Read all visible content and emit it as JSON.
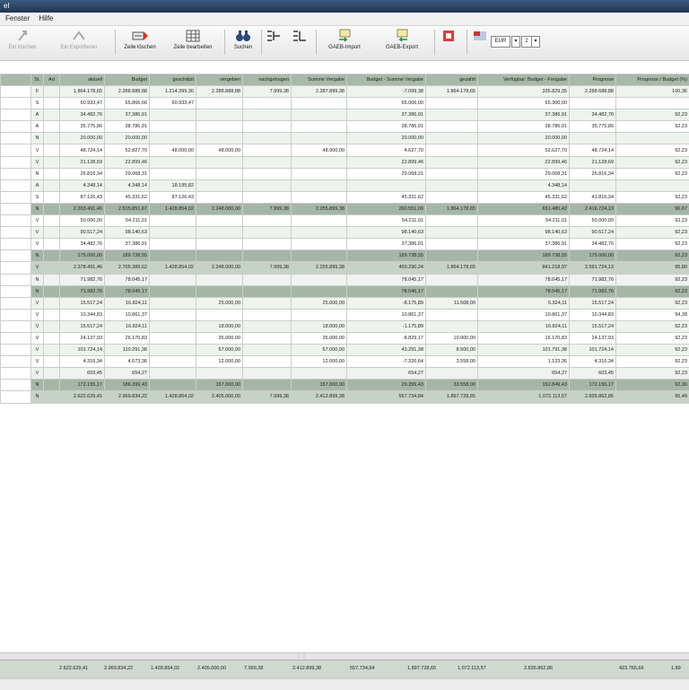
{
  "window": {
    "title": "el"
  },
  "menu": {
    "items": [
      "Fenster",
      "Hilfe"
    ]
  },
  "toolbar": {
    "buttons": [
      {
        "label": "Ein löschen",
        "icon": "disabled-arrow-icon"
      },
      {
        "label": "Ein Exportieren",
        "icon": "disabled-export-icon"
      },
      {
        "label": "Zeile löschen",
        "icon": "delete-row-icon"
      },
      {
        "label": "Zeile bearbeiten",
        "icon": "edit-row-icon"
      },
      {
        "label": "Suchen",
        "icon": "binoculars-icon"
      },
      {
        "label": "GAEB-Import",
        "icon": "gaeb-import-icon"
      },
      {
        "label": "GAEB-Export",
        "icon": "gaeb-export-icon"
      }
    ],
    "currency": "EUR",
    "decimals": "2"
  },
  "table": {
    "headers": [
      "",
      "St.",
      "Art",
      "aktuell",
      "Budget",
      "geschätzt",
      "vergeben",
      "nachgetragen",
      "Summe Vergabe",
      "Budget - Summe Vergabe",
      "gezahlt",
      "Verfügbar: Budget - Freigabe",
      "Prognose",
      "Prognose / Budget (%)"
    ],
    "rows": [
      {
        "type": "row",
        "c": [
          "",
          "F",
          "",
          "1.864.178,65",
          "2.288.888,88",
          "1.214.399,30",
          "2.288.888,88",
          "7.999,38",
          "2.287.899,38",
          "-7.099,38",
          "1.864.178,65",
          "335.829,35",
          "2.288.688,88",
          "100,36"
        ]
      },
      {
        "type": "row",
        "c": [
          "",
          "S",
          "",
          "60.933,47",
          "65.866,66",
          "60.933,47",
          "",
          "",
          "",
          "65.006,00",
          "",
          "65.300,00",
          "",
          ""
        ]
      },
      {
        "type": "row",
        "c": [
          "",
          "A",
          "",
          "34.482,76",
          "37.386,91",
          "",
          "",
          "",
          "",
          "37.386,91",
          "",
          "37.386,91",
          "34.482,76",
          "92,23"
        ]
      },
      {
        "type": "row",
        "c": [
          "",
          "A",
          "",
          "35.775,86",
          "38.786,91",
          "",
          "",
          "",
          "",
          "38.786,91",
          "",
          "38.786,91",
          "35.775,86",
          "92,23"
        ]
      },
      {
        "type": "row",
        "c": [
          "",
          "N",
          "",
          "20.000,00",
          "20.000,00",
          "",
          "",
          "",
          "",
          "20.000,00",
          "",
          "20.000,00",
          "",
          ""
        ]
      },
      {
        "type": "row",
        "c": [
          "",
          "V",
          "",
          "48.724,14",
          "52.827,70",
          "48.000,00",
          "48.000,00",
          "",
          "48.900,00",
          "4.627,70",
          "",
          "52.627,70",
          "48.724,14",
          "92,23"
        ]
      },
      {
        "type": "row",
        "c": [
          "",
          "V",
          "",
          "21.128,69",
          "22.899,46",
          "",
          "",
          "",
          "",
          "22.899,46",
          "",
          "22.899,46",
          "21.128,69",
          "92,23"
        ]
      },
      {
        "type": "row",
        "c": [
          "",
          "N",
          "",
          "26.816,34",
          "29.068,31",
          "",
          "",
          "",
          "",
          "29.068,31",
          "",
          "29.068,31",
          "26.816,34",
          "92,23"
        ]
      },
      {
        "type": "row",
        "c": [
          "",
          "A",
          "",
          "4.348,14",
          "4.348,14",
          "18.195,82",
          "",
          "",
          "",
          "",
          "",
          "4.348,14",
          "",
          ""
        ]
      },
      {
        "type": "row",
        "c": [
          "",
          "S",
          "",
          "87.126,43",
          "45.331,62",
          "87.126,43",
          "",
          "",
          "",
          "45.331,62",
          "",
          "45.331,62",
          "41.816,34",
          "92,23"
        ]
      },
      {
        "type": "sum",
        "c": [
          "",
          "N",
          "",
          "2.203.491,46",
          "2.515.851,67",
          "1.428.854,02",
          "2.248.000,00",
          "7.999,38",
          "2.255.899,38",
          "260.551,69",
          "1.864.178,65",
          "651.480,42",
          "2.416.724,13",
          "96,67"
        ]
      },
      {
        "type": "row",
        "c": [
          "",
          "V",
          "",
          "50.000,00",
          "54.211,01",
          "",
          "",
          "",
          "",
          "54.211,01",
          "",
          "54.211,01",
          "50.000,00",
          "92,23"
        ]
      },
      {
        "type": "row",
        "c": [
          "",
          "V",
          "",
          "90.517,24",
          "98.140,63",
          "",
          "",
          "",
          "",
          "98.140,63",
          "",
          "98.140,63",
          "90.517,24",
          "92,23"
        ]
      },
      {
        "type": "row",
        "c": [
          "",
          "V",
          "",
          "34.482,76",
          "37.386,91",
          "",
          "",
          "",
          "",
          "37.386,91",
          "",
          "37.386,91",
          "34.482,76",
          "92,23"
        ]
      },
      {
        "type": "sum",
        "c": [
          "",
          "N",
          "",
          "175.000,00",
          "189.738,55",
          "",
          "",
          "",
          "",
          "189.738,55",
          "",
          "189.738,55",
          "175.000,00",
          "92,23"
        ]
      },
      {
        "type": "sum2",
        "c": [
          "",
          "V",
          "",
          "2.378.491,46",
          "2.705.389,62",
          "1.428.854,02",
          "2.248.000,00",
          "7.999,38",
          "2.255.899,38",
          "450.290,24",
          "1.864.178,65",
          "841.218,97",
          "2.591.724,13",
          "95,80"
        ]
      },
      {
        "type": "row",
        "c": [
          "",
          "N",
          "",
          "71.982,76",
          "78.045,17",
          "",
          "",
          "",
          "",
          "78.045,17",
          "",
          "78.045,17",
          "71.982,76",
          "92,23"
        ]
      },
      {
        "type": "sum",
        "c": [
          "",
          "N",
          "",
          "71.982,76",
          "78.045,17",
          "",
          "",
          "",
          "",
          "78.045,17",
          "",
          "78.045,17",
          "71.982,76",
          "92,23"
        ]
      },
      {
        "type": "row",
        "c": [
          "",
          "V",
          "",
          "15.517,24",
          "16.824,11",
          "",
          "25.000,00",
          "",
          "25.000,00",
          "-8.175,89",
          "11.508,00",
          "5.324,11",
          "15.517,24",
          "92,23"
        ]
      },
      {
        "type": "row",
        "c": [
          "",
          "V",
          "",
          "10.344,83",
          "10.861,37",
          "",
          "",
          "",
          "",
          "10.861,37",
          "",
          "10.861,37",
          "10.344,83",
          "94,38"
        ]
      },
      {
        "type": "row",
        "c": [
          "",
          "V",
          "",
          "15.517,24",
          "16.824,11",
          "",
          "18.000,00",
          "",
          "18.000,00",
          "-1.175,89",
          "",
          "16.824,11",
          "15.517,24",
          "92,23"
        ]
      },
      {
        "type": "row",
        "c": [
          "",
          "V",
          "",
          "24.137,93",
          "26.170,83",
          "",
          "35.000,00",
          "",
          "35.000,00",
          "-8.829,17",
          "10.000,00",
          "16.170,83",
          "24.137,93",
          "92,23"
        ]
      },
      {
        "type": "row",
        "c": [
          "",
          "V",
          "",
          "101.724,14",
          "110.291,38",
          "",
          "67.000,00",
          "",
          "67.000,00",
          "43.291,38",
          "8.500,00",
          "101.791,38",
          "101.724,14",
          "92,23"
        ]
      },
      {
        "type": "row",
        "c": [
          "",
          "V",
          "",
          "4.316,34",
          "4.673,36",
          "",
          "12.000,00",
          "",
          "12.000,00",
          "-7.326,64",
          "3.558,00",
          "1.123,36",
          "4.316,34",
          "92,23"
        ]
      },
      {
        "type": "row",
        "c": [
          "",
          "V",
          "",
          "603,45",
          "654,27",
          "",
          "",
          "",
          "",
          "654,27",
          "",
          "654,27",
          "603,45",
          "92,23"
        ]
      },
      {
        "type": "sum",
        "c": [
          "",
          "N",
          "",
          "172.155,17",
          "186.399,43",
          "",
          "157.000,00",
          "",
          "157.000,00",
          "29.399,43",
          "33.558,00",
          "152.849,43",
          "172.155,17",
          "92,36"
        ]
      },
      {
        "type": "sum2",
        "c": [
          "",
          "N",
          "",
          "2.622.629,41",
          "2.969.834,22",
          "1.428.854,02",
          "2.405.000,00",
          "7.999,38",
          "2.412.899,38",
          "557.734,84",
          "1.897.728,65",
          "1.072.113,57",
          "2.835.862,86",
          "95,49"
        ]
      }
    ]
  },
  "footer": {
    "values": [
      "2.622.629,41",
      "2.969.834,22",
      "1.428.854,02",
      "2.405.000,00",
      "7.999,38",
      "2.412.899,38",
      "557.734,84",
      "1.897.728,65",
      "1.072.113,57",
      "2.835.862,86",
      "423.765,66",
      "1.89"
    ]
  }
}
